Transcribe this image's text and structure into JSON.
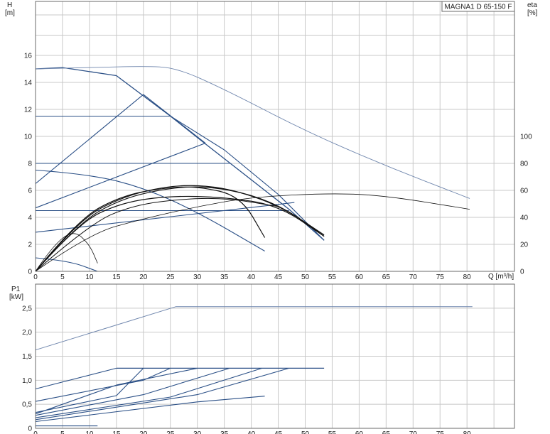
{
  "model_label": "MAGNA1 D 65-150 F",
  "colors": {
    "blue": "#2a4f86",
    "blue_light": "#6f86ad",
    "black": "#111111",
    "gray": "#555555",
    "grid": "#c8c8c8"
  },
  "chart_data": [
    {
      "type": "line",
      "id": "head",
      "xlabel": "Q [m³/h]",
      "ylabel_line1": "H",
      "ylabel_line2": "[m]",
      "y2label_line1": "eta",
      "y2label_line2": "[%]",
      "xlim": [
        0,
        88
      ],
      "ylim": [
        0,
        20
      ],
      "y2lim": [
        0,
        200
      ],
      "x_ticks": [
        0,
        5,
        10,
        15,
        20,
        25,
        30,
        35,
        40,
        45,
        50,
        55,
        60,
        65,
        70,
        75,
        80
      ],
      "y_ticks": [
        0,
        2,
        4,
        6,
        8,
        10,
        12,
        14,
        16
      ],
      "y2_ticks": [
        0,
        20,
        40,
        60,
        80,
        100
      ],
      "grid": true,
      "series": [
        {
          "kind": "qh_max",
          "color": "blue",
          "width": 1.3,
          "points": [
            [
              0,
              15
            ],
            [
              5,
              15.1
            ],
            [
              15,
              14.5
            ],
            [
              25,
              11.5
            ],
            [
              31,
              9.6
            ],
            [
              47,
              4.6
            ],
            [
              53.5,
              2.3
            ]
          ]
        },
        {
          "kind": "qh_const",
          "color": "blue",
          "width": 1.1,
          "points": [
            [
              0,
              11.5
            ],
            [
              25,
              11.5
            ]
          ]
        },
        {
          "kind": "qh_const",
          "color": "blue",
          "width": 1.1,
          "points": [
            [
              0,
              8
            ],
            [
              36,
              8
            ]
          ]
        },
        {
          "kind": "qh_const",
          "color": "blue",
          "width": 1.1,
          "points": [
            [
              0,
              4.5
            ],
            [
              47,
              4.5
            ]
          ]
        },
        {
          "kind": "qh_prop",
          "color": "blue",
          "width": 1.1,
          "points": [
            [
              0,
              6.5
            ],
            [
              20,
              13.1
            ],
            [
              31.5,
              9.5
            ]
          ]
        },
        {
          "kind": "qh_prop",
          "color": "blue",
          "width": 1.1,
          "points": [
            [
              0,
              4.7
            ],
            [
              31.5,
              9.5
            ]
          ]
        },
        {
          "kind": "qh_prop",
          "color": "blue",
          "width": 1.1,
          "points": [
            [
              0,
              2.9
            ],
            [
              48,
              5.1
            ]
          ]
        },
        {
          "kind": "qh_max_right",
          "color": "blue",
          "width": 1.1,
          "points": [
            [
              25,
              11.5
            ],
            [
              35,
              9
            ],
            [
              45,
              5.7
            ],
            [
              53.5,
              2.3
            ]
          ]
        },
        {
          "kind": "qh_speed",
          "color": "blue",
          "width": 1.1,
          "points": [
            [
              0,
              7.5
            ],
            [
              10,
              7.2
            ],
            [
              20,
              6.2
            ],
            [
              30,
              4.4
            ],
            [
              42.5,
              1.5
            ]
          ]
        },
        {
          "kind": "qh_speed",
          "color": "blue",
          "width": 1.1,
          "points": [
            [
              0,
              1
            ],
            [
              6,
              0.8
            ],
            [
              11.5,
              0
            ]
          ]
        },
        {
          "kind": "eta",
          "color": "blue_light",
          "width": 0.9,
          "points": [
            [
              0,
              15
            ],
            [
              10,
              15.1
            ],
            [
              20,
              15.2
            ],
            [
              26,
              15.1
            ],
            [
              35,
              13.5
            ],
            [
              50,
              10.4
            ],
            [
              65,
              7.8
            ],
            [
              80.5,
              5.4
            ]
          ]
        },
        {
          "kind": "eta",
          "color": "black",
          "width": 0.8,
          "points": [
            [
              0,
              0
            ],
            [
              10,
              2.8
            ],
            [
              20,
              3.9
            ],
            [
              30,
              4.8
            ],
            [
              40,
              5.5
            ],
            [
              55,
              5.8
            ],
            [
              65,
              5.6
            ],
            [
              80.5,
              4.6
            ]
          ]
        },
        {
          "kind": "eta",
          "color": "black",
          "width": 0.8,
          "points": [
            [
              0,
              0
            ],
            [
              3,
              1.8
            ],
            [
              7,
              3.1
            ],
            [
              10,
              2
            ],
            [
              11.5,
              0.6
            ]
          ]
        },
        {
          "kind": "eta",
          "color": "black",
          "width": 1.2,
          "points": [
            [
              0,
              0
            ],
            [
              8,
              3.6
            ],
            [
              16,
              5.4
            ],
            [
              25,
              6.2
            ],
            [
              32,
              6.3
            ],
            [
              40,
              5.7
            ],
            [
              47,
              4.5
            ],
            [
              53.5,
              2.6
            ]
          ]
        },
        {
          "kind": "eta",
          "color": "black",
          "width": 1.2,
          "points": [
            [
              0,
              0
            ],
            [
              8,
              3.8
            ],
            [
              16,
              5.5
            ],
            [
              24,
              6.3
            ],
            [
              31,
              6.4
            ],
            [
              38,
              5.9
            ],
            [
              46,
              4.7
            ],
            [
              53.5,
              2.7
            ]
          ]
        },
        {
          "kind": "eta",
          "color": "black",
          "width": 1.2,
          "points": [
            [
              0,
              0
            ],
            [
              8,
              3.9
            ],
            [
              16,
              5.6
            ],
            [
              24,
              6.2
            ],
            [
              30,
              6.3
            ],
            [
              38,
              5.6
            ],
            [
              42.5,
              2.5
            ]
          ]
        },
        {
          "kind": "eta",
          "color": "black",
          "width": 1.2,
          "points": [
            [
              0,
              0
            ],
            [
              8,
              3.6
            ],
            [
              16,
              5.1
            ],
            [
              25,
              5.6
            ],
            [
              35,
              5.5
            ],
            [
              45,
              4.9
            ],
            [
              53.5,
              2.6
            ]
          ]
        },
        {
          "kind": "eta",
          "color": "black",
          "width": 1.0,
          "points": [
            [
              0,
              0
            ],
            [
              10,
              3.5
            ],
            [
              18,
              4.9
            ],
            [
              28,
              5.4
            ],
            [
              36,
              5.4
            ],
            [
              45,
              4.8
            ]
          ]
        }
      ]
    },
    {
      "type": "line",
      "id": "power",
      "xlabel": "",
      "ylabel_line1": "P1",
      "ylabel_line2": "[kW]",
      "xlim": [
        0,
        88
      ],
      "ylim": [
        0,
        3
      ],
      "x_ticks": [
        0,
        5,
        10,
        15,
        20,
        25,
        30,
        35,
        40,
        45,
        50,
        55,
        60,
        65,
        70,
        75,
        80
      ],
      "y_ticks": [
        "0",
        "0,5",
        "1,0",
        "1,5",
        "2,0",
        "2,5"
      ],
      "y_tick_values": [
        0,
        0.5,
        1,
        1.5,
        2,
        2.5
      ],
      "grid": true,
      "series": [
        {
          "kind": "p_max",
          "color": "blue_light",
          "width": 1.0,
          "points": [
            [
              0,
              1.63
            ],
            [
              26,
              2.53
            ],
            [
              81,
              2.53
            ]
          ]
        },
        {
          "kind": "p",
          "color": "blue",
          "width": 1.2,
          "points": [
            [
              15,
              1.25
            ],
            [
              53.5,
              1.25
            ]
          ]
        },
        {
          "kind": "p",
          "color": "blue",
          "width": 1.1,
          "points": [
            [
              0,
              0.82
            ],
            [
              15,
              1.25
            ]
          ]
        },
        {
          "kind": "p",
          "color": "blue",
          "width": 1.1,
          "points": [
            [
              0,
              0.56
            ],
            [
              20,
              1.0
            ],
            [
              25,
              1.25
            ]
          ]
        },
        {
          "kind": "p",
          "color": "blue",
          "width": 1.1,
          "points": [
            [
              0,
              0.33
            ],
            [
              15,
              0.68
            ],
            [
              20,
              1.25
            ]
          ]
        },
        {
          "kind": "p",
          "color": "blue",
          "width": 1.1,
          "points": [
            [
              0,
              0.3
            ],
            [
              15,
              0.9
            ],
            [
              30,
              1.25
            ]
          ]
        },
        {
          "kind": "p",
          "color": "blue",
          "width": 1.1,
          "points": [
            [
              0,
              0.27
            ],
            [
              20,
              0.7
            ],
            [
              36,
              1.25
            ]
          ]
        },
        {
          "kind": "p",
          "color": "blue",
          "width": 1.1,
          "points": [
            [
              0,
              0.22
            ],
            [
              25,
              0.65
            ],
            [
              42,
              1.25
            ]
          ]
        },
        {
          "kind": "p",
          "color": "blue",
          "width": 1.1,
          "points": [
            [
              0,
              0.18
            ],
            [
              30,
              0.7
            ],
            [
              47,
              1.25
            ]
          ]
        },
        {
          "kind": "p",
          "color": "blue",
          "width": 1.1,
          "points": [
            [
              0,
              0.14
            ],
            [
              30,
              0.55
            ],
            [
              42.5,
              0.67
            ]
          ]
        },
        {
          "kind": "p",
          "color": "blue",
          "width": 1.1,
          "points": [
            [
              0,
              0.05
            ],
            [
              11.5,
              0.05
            ]
          ]
        }
      ]
    }
  ]
}
